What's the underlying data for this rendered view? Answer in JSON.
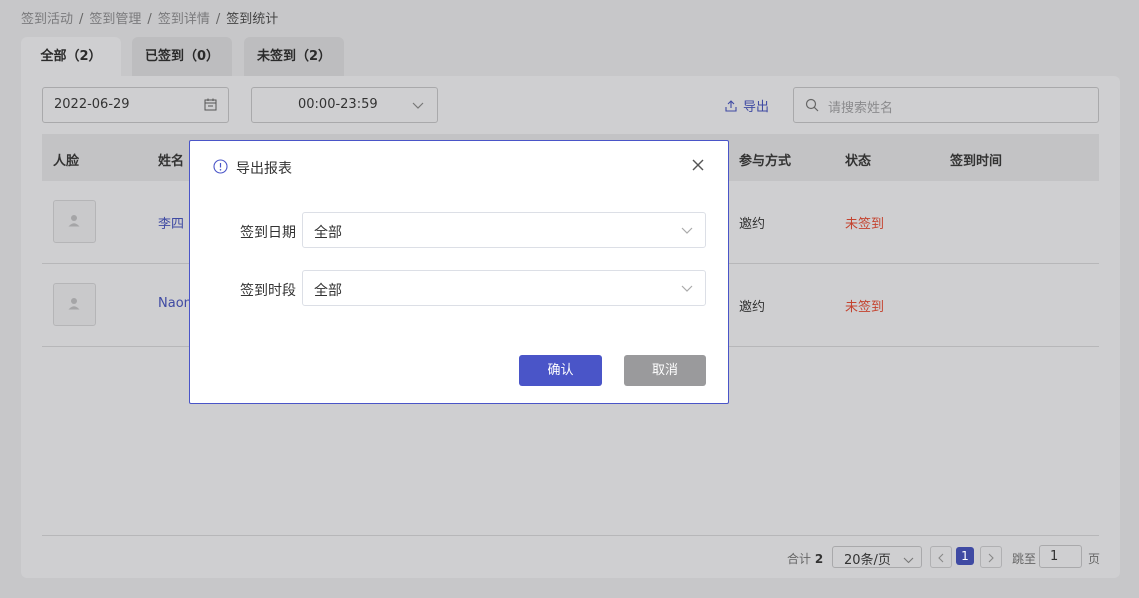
{
  "breadcrumb": {
    "items": [
      "签到活动",
      "签到管理",
      "签到详情",
      "签到统计"
    ],
    "separator": "/"
  },
  "tabs": [
    {
      "label": "全部（2）",
      "active": true
    },
    {
      "label": "已签到（0）",
      "active": false
    },
    {
      "label": "未签到（2）",
      "active": false
    }
  ],
  "filters": {
    "date_value": "2022-06-29",
    "time_value": "00:00-23:59",
    "export_label": "导出",
    "search_placeholder": "请搜索姓名"
  },
  "table": {
    "columns": [
      "人脸",
      "姓名",
      "参与方式",
      "状态",
      "签到时间"
    ],
    "rows": [
      {
        "name": "李四",
        "method": "邀约",
        "status": "未签到",
        "time": ""
      },
      {
        "name": "Naon",
        "method": "邀约",
        "status": "未签到",
        "time": ""
      }
    ]
  },
  "pagination": {
    "total_label": "合计",
    "total": "2",
    "page_size": "20条/页",
    "current_page": "1",
    "jump_label": "跳至",
    "jump_value": "1",
    "page_unit": "页"
  },
  "modal": {
    "title": "导出报表",
    "fields": [
      {
        "label": "签到日期",
        "value": "全部"
      },
      {
        "label": "签到时段",
        "value": "全部"
      }
    ],
    "confirm_label": "确认",
    "cancel_label": "取消"
  },
  "colors": {
    "accent": "#4a55c8",
    "link": "#3f4aa3",
    "status_unsigned": "#c4432f",
    "overlay": "#c7c7c9"
  },
  "icons": [
    "calendar-icon",
    "chevron-down-icon",
    "upload-icon",
    "search-icon",
    "user-icon",
    "info-icon",
    "close-icon",
    "chevron-left-icon",
    "chevron-right-icon"
  ]
}
